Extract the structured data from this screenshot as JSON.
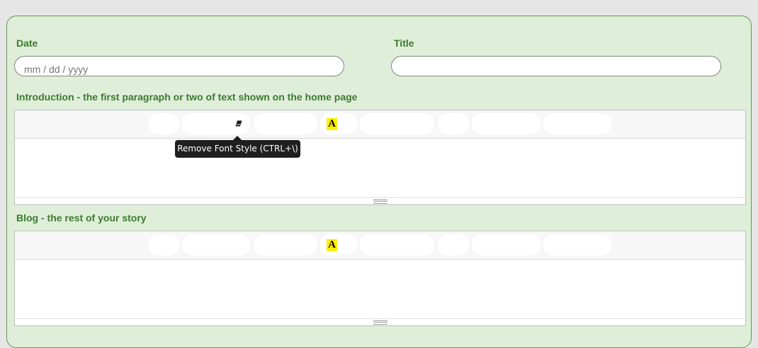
{
  "form": {
    "date_label": "Date",
    "date_placeholder": "mm / dd / yyyy",
    "title_label": "Title",
    "title_value": "",
    "intro_label": "Introduction - the first paragraph or two of text shown on the home page",
    "blog_label": "Blog - the rest of your story"
  },
  "toolbar": {
    "font_color_glyph": "A",
    "tooltip": "Remove Font Style (CTRL+\\)"
  },
  "colors": {
    "panel_background": "#dfeed9",
    "label_green": "#3c7a2f",
    "font_color_highlight": "#ffee00"
  }
}
